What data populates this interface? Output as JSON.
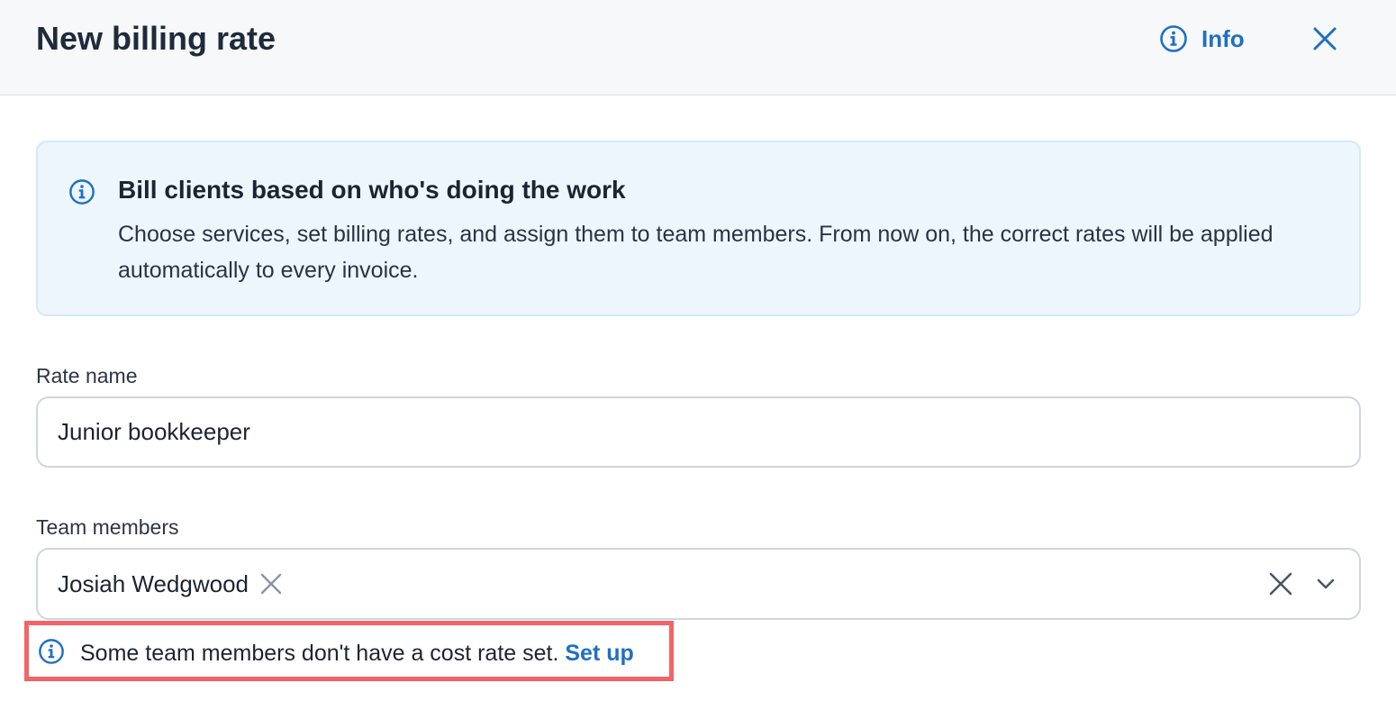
{
  "modal": {
    "title": "New billing rate",
    "info_label": "Info"
  },
  "banner": {
    "title": "Bill clients based on who's doing the work",
    "body": "Choose services, set billing rates, and assign them to team members. From now on, the correct rates will be applied automatically to every invoice."
  },
  "form": {
    "rate_name_label": "Rate name",
    "rate_name_value": "Junior bookkeeper",
    "team_members_label": "Team members",
    "team_members_selected": [
      "Josiah Wedgwood"
    ]
  },
  "warning": {
    "text": "Some team members don't have a cost rate set.",
    "link": "Set up"
  },
  "colors": {
    "accent": "#1f6fc5",
    "banner_bg": "#edf5fd",
    "highlight_border": "#f26466",
    "header_bg": "#f6f8fa"
  },
  "icons": {
    "info": "info-circle-icon",
    "close": "close-icon",
    "chip_remove": "x-icon",
    "clear": "clear-icon",
    "caret": "chevron-down-icon"
  }
}
